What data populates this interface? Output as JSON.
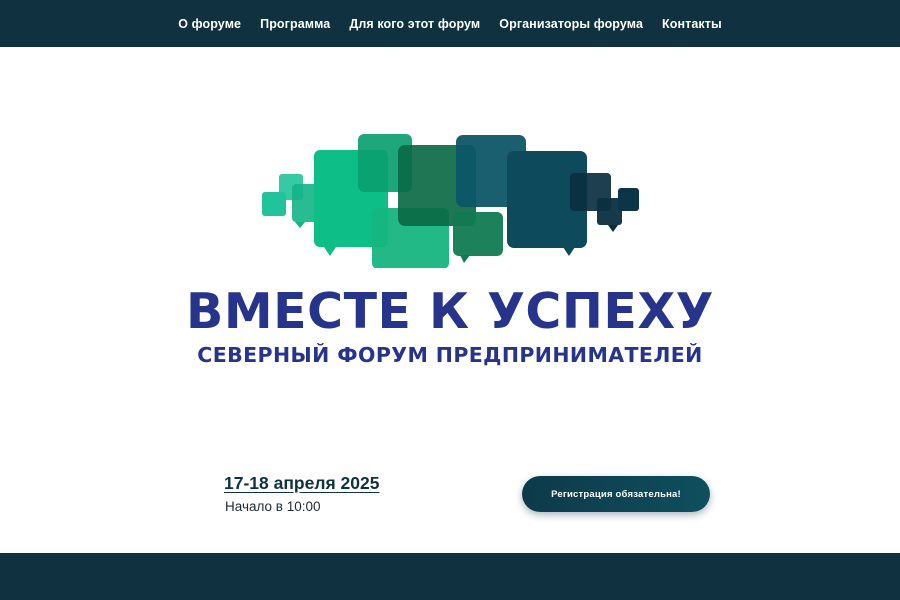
{
  "nav": {
    "items": [
      {
        "label": "О форуме"
      },
      {
        "label": "Программа"
      },
      {
        "label": "Для кого этот форум"
      },
      {
        "label": "Организаторы форума"
      },
      {
        "label": "Контакты"
      }
    ]
  },
  "hero": {
    "logo_icon": "speech-bubbles-logo-icon",
    "title": "ВМЕСТЕ К УСПЕХУ",
    "subtitle": "СЕВЕРНЫЙ ФОРУМ ПРЕДПРИНИМАТЕЛЕЙ"
  },
  "event": {
    "date": "17-18 апреля 2025",
    "start_time": "Начало в 10:00",
    "register_label": "Регистрация обязательна!"
  },
  "colors": {
    "header_bg": "#0f3140",
    "title_color": "#26348c",
    "bubble_green_light": "#0dbf86",
    "bubble_green": "#0aa070",
    "bubble_dark_green": "#0b6a46",
    "bubble_teal": "#0d5668",
    "bubble_navy": "#0d3548"
  }
}
